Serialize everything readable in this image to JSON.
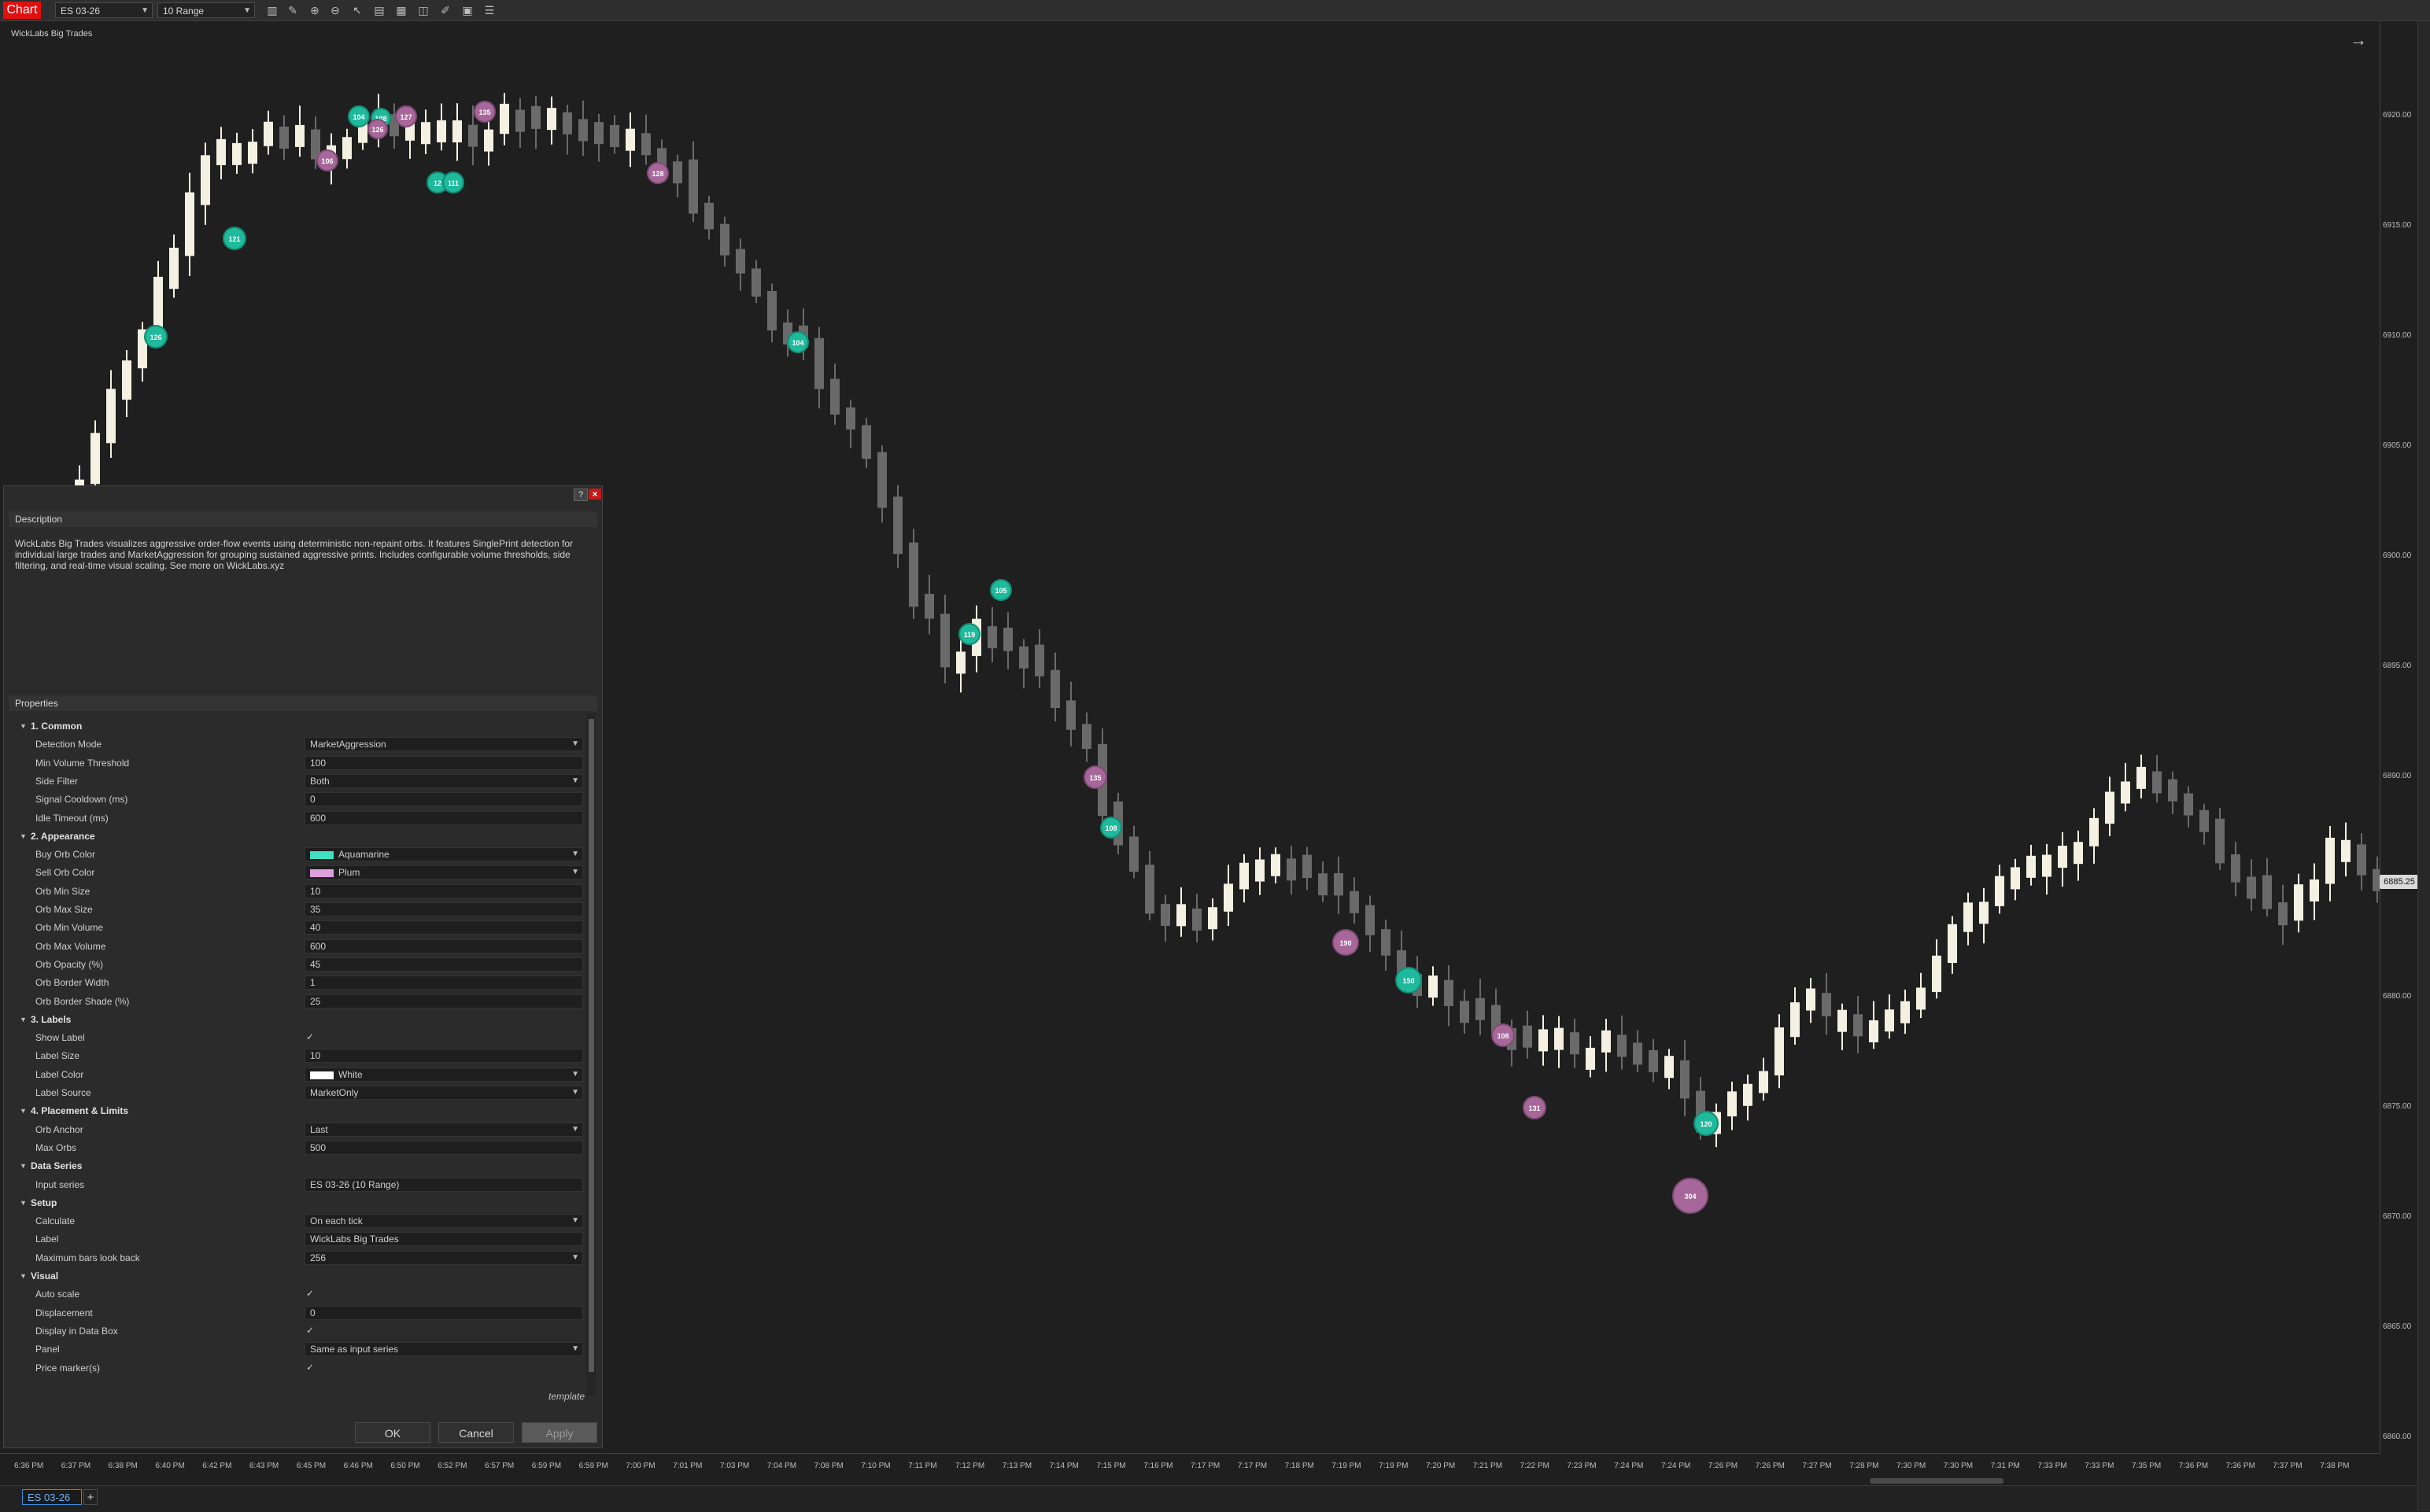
{
  "toolbar": {
    "chart_tab": "Chart",
    "instrument": "ES 03-26",
    "interval": "10 Range",
    "icons": [
      "bar-type-icon",
      "draw-pencil-icon",
      "zoom-in-icon",
      "zoom-out-icon",
      "pointer-icon",
      "data-box-icon",
      "chart-trader-icon",
      "screenshot-icon",
      "drawing-tools-icon",
      "properties-icon",
      "indicators-icon"
    ]
  },
  "chart": {
    "indicator_label": "WickLabs Big Trades",
    "last_price": "6885.25",
    "price_labels": [
      "6920.00",
      "6915.00",
      "6910.00",
      "6905.00",
      "6900.00",
      "6895.00",
      "6890.00",
      "6880.00",
      "6875.00",
      "6870.00",
      "6865.00",
      "6860.00"
    ],
    "time_labels": [
      "6:36 PM",
      "6:37 PM",
      "6:38 PM",
      "6:40 PM",
      "6:42 PM",
      "6:43 PM",
      "6:45 PM",
      "6:46 PM",
      "6:50 PM",
      "6:52 PM",
      "6:57 PM",
      "6:59 PM",
      "6:59 PM",
      "7:00 PM",
      "7:01 PM",
      "7:03 PM",
      "7:04 PM",
      "7:08 PM",
      "7:10 PM",
      "7:11 PM",
      "7:12 PM",
      "7:13 PM",
      "7:14 PM",
      "7:15 PM",
      "7:16 PM",
      "7:17 PM",
      "7:17 PM",
      "7:18 PM",
      "7:19 PM",
      "7:19 PM",
      "7:20 PM",
      "7:21 PM",
      "7:22 PM",
      "7:23 PM",
      "7:24 PM",
      "7:24 PM",
      "7:26 PM",
      "7:26 PM",
      "7:27 PM",
      "7:28 PM",
      "7:30 PM",
      "7:30 PM",
      "7:31 PM",
      "7:33 PM",
      "7:33 PM",
      "7:35 PM",
      "7:36 PM",
      "7:36 PM",
      "7:37 PM",
      "7:38 PM"
    ],
    "orbs": [
      {
        "label": "126",
        "side": "buy"
      },
      {
        "label": "121",
        "side": "buy"
      },
      {
        "label": "106",
        "side": "sell"
      },
      {
        "label": "104",
        "side": "buy"
      },
      {
        "label": "108",
        "side": "buy"
      },
      {
        "label": "126",
        "side": "sell"
      },
      {
        "label": "127",
        "side": "sell"
      },
      {
        "label": "135",
        "side": "sell"
      },
      {
        "label": "12",
        "side": "buy"
      },
      {
        "label": "111",
        "side": "buy"
      },
      {
        "label": "128",
        "side": "sell"
      },
      {
        "label": "104",
        "side": "buy"
      },
      {
        "label": "119",
        "side": "buy"
      },
      {
        "label": "105",
        "side": "buy"
      },
      {
        "label": "135",
        "side": "sell"
      },
      {
        "label": "108",
        "side": "buy"
      },
      {
        "label": "190",
        "side": "sell"
      },
      {
        "label": "150",
        "side": "buy"
      },
      {
        "label": "108",
        "side": "sell"
      },
      {
        "label": "131",
        "side": "sell"
      },
      {
        "label": "120",
        "side": "buy"
      },
      {
        "label": "304",
        "side": "sell"
      }
    ],
    "colors": {
      "bull": "#f4f1e2",
      "bear": "#6a6a6a",
      "buy_orb": "#1fb99b",
      "sell_orb": "#a8679a"
    }
  },
  "dialog": {
    "description_header": "Description",
    "description": "WickLabs Big Trades visualizes aggressive order-flow events using deterministic non-repaint orbs. It features SinglePrint detection for individual large trades and MarketAggression for grouping sustained aggressive prints. Includes configurable volume thresholds, side filtering, and real-time visual scaling. See more on WickLabs.xyz",
    "properties_header": "Properties",
    "categories": [
      {
        "name": "1. Common",
        "rows": [
          {
            "label": "Detection Mode",
            "value": "MarketAggression",
            "dropdown": true
          },
          {
            "label": "Min Volume Threshold",
            "value": "100"
          },
          {
            "label": "Side Filter",
            "value": "Both",
            "dropdown": true
          },
          {
            "label": "Signal Cooldown (ms)",
            "value": "0"
          },
          {
            "label": "Idle Timeout (ms)",
            "value": "600"
          }
        ]
      },
      {
        "name": "2. Appearance",
        "rows": [
          {
            "label": "Buy Orb Color",
            "value": "Aquamarine",
            "dropdown": true,
            "swatch": "#40e0c0"
          },
          {
            "label": "Sell Orb Color",
            "value": "Plum",
            "dropdown": true,
            "swatch": "#dda0dd"
          },
          {
            "label": "Orb Min Size",
            "value": "10"
          },
          {
            "label": "Orb Max Size",
            "value": "35"
          },
          {
            "label": "Orb Min Volume",
            "value": "40"
          },
          {
            "label": "Orb Max Volume",
            "value": "600"
          },
          {
            "label": "Orb Opacity (%)",
            "value": "45"
          },
          {
            "label": "Orb Border Width",
            "value": "1"
          },
          {
            "label": "Orb Border Shade (%)",
            "value": "25"
          }
        ]
      },
      {
        "name": "3. Labels",
        "rows": [
          {
            "label": "Show Label",
            "value": "✓",
            "check": true
          },
          {
            "label": "Label Size",
            "value": "10"
          },
          {
            "label": "Label Color",
            "value": "White",
            "dropdown": true,
            "swatch": "#ffffff"
          },
          {
            "label": "Label Source",
            "value": "MarketOnly",
            "dropdown": true
          }
        ]
      },
      {
        "name": "4. Placement & Limits",
        "rows": [
          {
            "label": "Orb Anchor",
            "value": "Last",
            "dropdown": true
          },
          {
            "label": "Max Orbs",
            "value": "500"
          }
        ]
      },
      {
        "name": "Data Series",
        "rows": [
          {
            "label": "Input series",
            "value": "ES 03-26 (10 Range)"
          }
        ]
      },
      {
        "name": "Setup",
        "rows": [
          {
            "label": "Calculate",
            "value": "On each tick",
            "dropdown": true
          },
          {
            "label": "Label",
            "value": "WickLabs Big Trades"
          },
          {
            "label": "Maximum bars look back",
            "value": "256",
            "dropdown": true
          }
        ]
      },
      {
        "name": "Visual",
        "rows": [
          {
            "label": "Auto scale",
            "value": "✓",
            "check": true
          },
          {
            "label": "Displacement",
            "value": "0"
          },
          {
            "label": "Display in Data Box",
            "value": "✓",
            "check": true
          },
          {
            "label": "Panel",
            "value": "Same as input series",
            "dropdown": true
          },
          {
            "label": "Price marker(s)",
            "value": "✓",
            "check": true
          }
        ]
      }
    ],
    "template_link": "template",
    "ok": "OK",
    "cancel": "Cancel",
    "apply": "Apply"
  },
  "bottom_tab": {
    "label": "ES 03-26",
    "add": "+"
  }
}
